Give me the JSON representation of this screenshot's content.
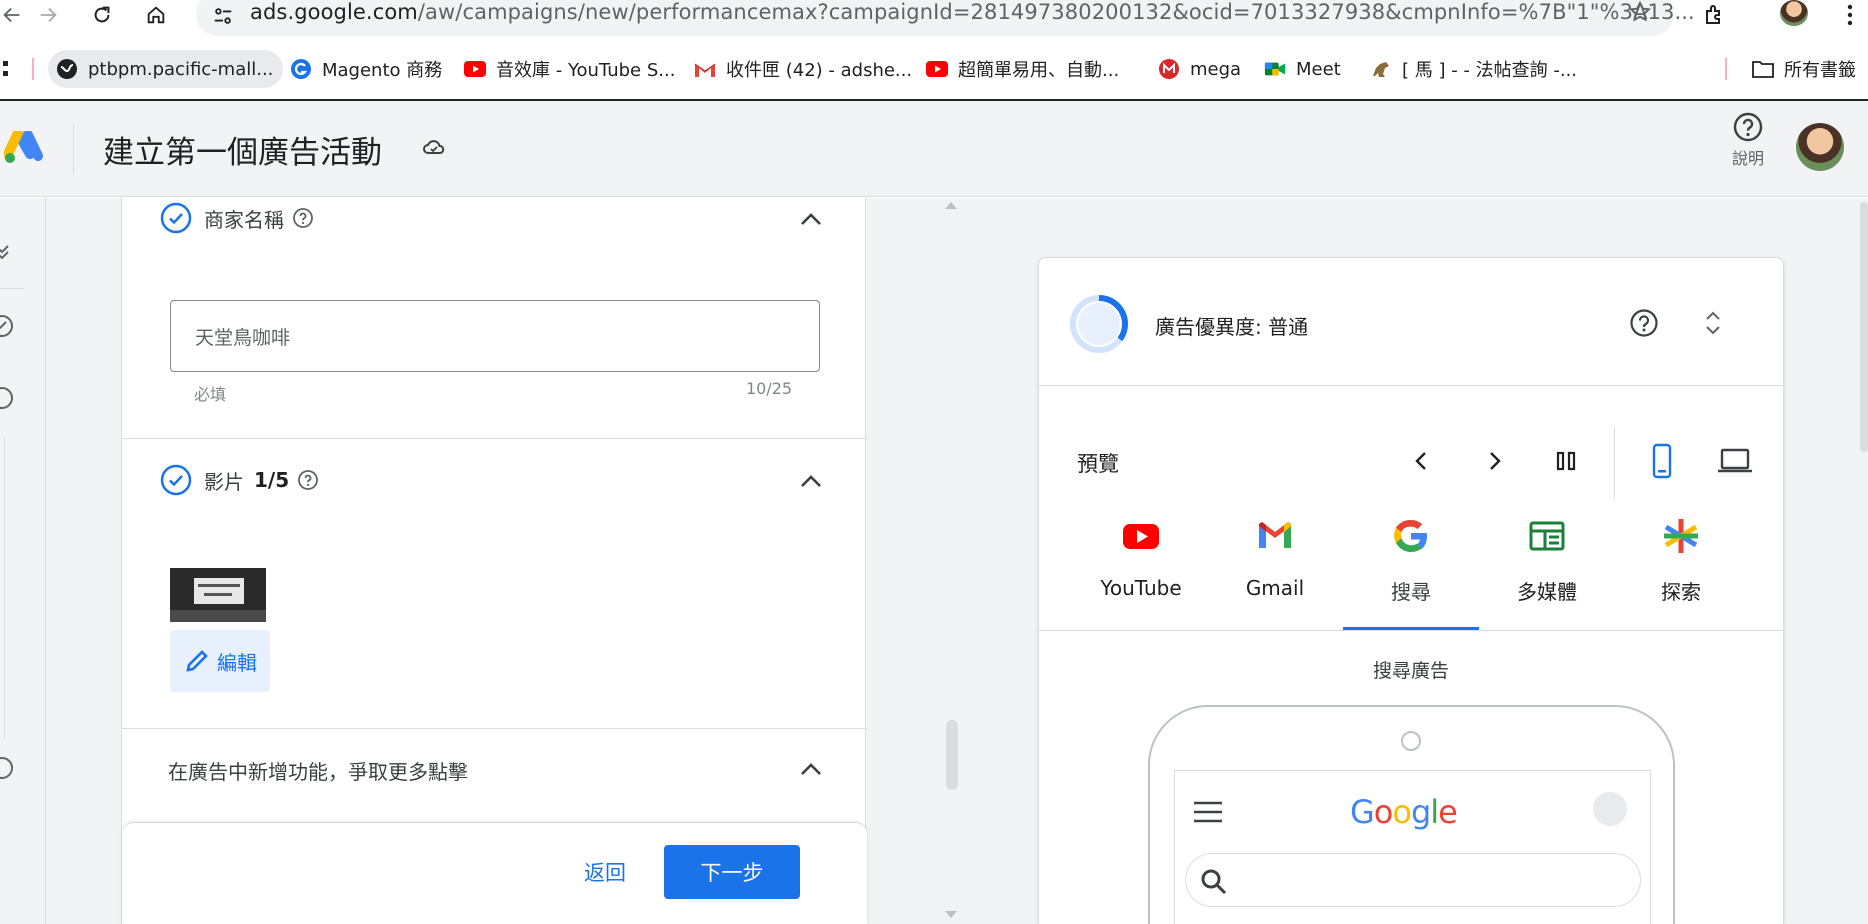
{
  "browser": {
    "url_host": "ads.google.com",
    "url_path": "/aw/campaigns/new/performancemax?campaignId=281497380200132&ocid=7013327938&cmpnInfo=%7B\"1\"%3A13...",
    "bookmarks": [
      {
        "label": "ptbpm.pacific-mall..."
      },
      {
        "label": "Magento 商務"
      },
      {
        "label": "音效庫 - YouTube S..."
      },
      {
        "label": "收件匣 (42) - adshe..."
      },
      {
        "label": "超簡單易用、自動..."
      },
      {
        "label": "mega"
      },
      {
        "label": "Meet"
      },
      {
        "label": "[ 馬 ] - - 法帖查詢 -..."
      },
      {
        "label": "所有書籤"
      }
    ]
  },
  "header": {
    "title": "建立第一個廣告活動",
    "help_label": "說明"
  },
  "form": {
    "business_name": {
      "title": "商家名稱",
      "value": "天堂鳥咖啡",
      "hint": "必填",
      "counter": "10/25"
    },
    "videos": {
      "title": "影片",
      "count": "1/5",
      "edit_label": "編輯"
    },
    "features": {
      "title": "在廣告中新增功能，爭取更多點擊"
    },
    "footer": {
      "back_label": "返回",
      "next_label": "下一步"
    }
  },
  "preview": {
    "ad_strength": "廣告優異度: 普通",
    "ad_strength_level": 0.35,
    "label": "預覽",
    "channels": [
      {
        "label": "YouTube",
        "icon": "youtube-icon"
      },
      {
        "label": "Gmail",
        "icon": "gmail-icon"
      },
      {
        "label": "搜尋",
        "icon": "google-icon",
        "active": true
      },
      {
        "label": "多媒體",
        "icon": "display-icon"
      },
      {
        "label": "探索",
        "icon": "discover-icon"
      }
    ],
    "ad_type": "搜尋廣告",
    "google_word": "Google"
  },
  "colors": {
    "accent": "#1a73e8",
    "youtube_red": "#ff0000",
    "google_blue": "#4285f4",
    "google_red": "#ea4335",
    "google_yellow": "#fbbc04",
    "google_green": "#34a853"
  }
}
